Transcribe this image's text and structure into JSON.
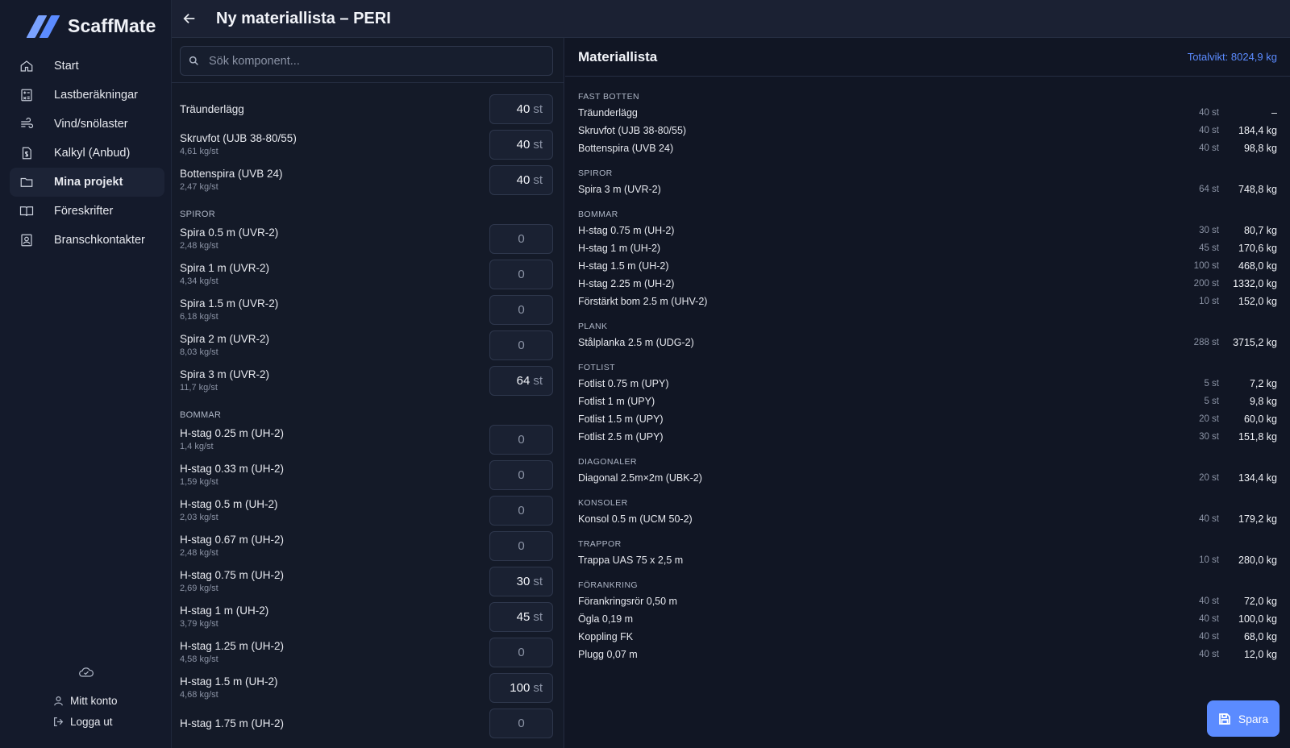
{
  "app": {
    "name": "ScaffMate"
  },
  "sidebar": {
    "items": [
      {
        "label": "Start",
        "icon": "home-icon"
      },
      {
        "label": "Lastberäkningar",
        "icon": "calculator-icon"
      },
      {
        "label": "Vind/snölaster",
        "icon": "wind-icon"
      },
      {
        "label": "Kalkyl (Anbud)",
        "icon": "invoice-icon"
      },
      {
        "label": "Mina projekt",
        "icon": "folder-icon",
        "active": true
      },
      {
        "label": "Föreskrifter",
        "icon": "book-icon"
      },
      {
        "label": "Branschkontakter",
        "icon": "contacts-icon"
      }
    ],
    "account_label": "Mitt konto",
    "logout_label": "Logga ut"
  },
  "header": {
    "title": "Ny materiallista – PERI"
  },
  "search": {
    "placeholder": "Sök komponent..."
  },
  "components": {
    "ungrouped": [
      {
        "name": "Träunderlägg",
        "weight": "",
        "qty": "40",
        "unit": "st"
      },
      {
        "name": "Skruvfot (UJB 38-80/55)",
        "weight": "4,61 kg/st",
        "qty": "40",
        "unit": "st"
      },
      {
        "name": "Bottenspira (UVB 24)",
        "weight": "2,47 kg/st",
        "qty": "40",
        "unit": "st"
      }
    ],
    "spiror_label": "SPIROR",
    "spiror": [
      {
        "name": "Spira 0.5 m (UVR-2)",
        "weight": "2,48 kg/st",
        "qty": "0",
        "unit": ""
      },
      {
        "name": "Spira 1 m (UVR-2)",
        "weight": "4,34 kg/st",
        "qty": "0",
        "unit": ""
      },
      {
        "name": "Spira 1.5 m (UVR-2)",
        "weight": "6,18 kg/st",
        "qty": "0",
        "unit": ""
      },
      {
        "name": "Spira 2 m (UVR-2)",
        "weight": "8,03 kg/st",
        "qty": "0",
        "unit": ""
      },
      {
        "name": "Spira 3 m (UVR-2)",
        "weight": "11,7 kg/st",
        "qty": "64",
        "unit": "st"
      }
    ],
    "bommar_label": "BOMMAR",
    "bommar": [
      {
        "name": "H-stag 0.25 m (UH-2)",
        "weight": "1,4 kg/st",
        "qty": "0",
        "unit": ""
      },
      {
        "name": "H-stag 0.33 m (UH-2)",
        "weight": "1,59 kg/st",
        "qty": "0",
        "unit": ""
      },
      {
        "name": "H-stag 0.5 m (UH-2)",
        "weight": "2,03 kg/st",
        "qty": "0",
        "unit": ""
      },
      {
        "name": "H-stag 0.67 m (UH-2)",
        "weight": "2,48 kg/st",
        "qty": "0",
        "unit": ""
      },
      {
        "name": "H-stag 0.75 m (UH-2)",
        "weight": "2,69 kg/st",
        "qty": "30",
        "unit": "st"
      },
      {
        "name": "H-stag 1 m (UH-2)",
        "weight": "3,79 kg/st",
        "qty": "45",
        "unit": "st"
      },
      {
        "name": "H-stag 1.25 m (UH-2)",
        "weight": "4,58 kg/st",
        "qty": "0",
        "unit": ""
      },
      {
        "name": "H-stag 1.5 m (UH-2)",
        "weight": "4,68 kg/st",
        "qty": "100",
        "unit": "st"
      },
      {
        "name": "H-stag 1.75 m (UH-2)",
        "weight": "",
        "qty": "0",
        "unit": ""
      }
    ]
  },
  "materials": {
    "title": "Materiallista",
    "total": "Totalvikt: 8024,9 kg",
    "groups": [
      {
        "label": "FAST BOTTEN",
        "rows": [
          {
            "name": "Träunderlägg",
            "qty": "40 st",
            "weight": "–"
          },
          {
            "name": "Skruvfot (UJB 38-80/55)",
            "qty": "40 st",
            "weight": "184,4 kg"
          },
          {
            "name": "Bottenspira (UVB 24)",
            "qty": "40 st",
            "weight": "98,8 kg"
          }
        ]
      },
      {
        "label": "SPIROR",
        "rows": [
          {
            "name": "Spira 3 m (UVR-2)",
            "qty": "64 st",
            "weight": "748,8 kg"
          }
        ]
      },
      {
        "label": "BOMMAR",
        "rows": [
          {
            "name": "H-stag 0.75 m (UH-2)",
            "qty": "30 st",
            "weight": "80,7 kg"
          },
          {
            "name": "H-stag 1 m (UH-2)",
            "qty": "45 st",
            "weight": "170,6 kg"
          },
          {
            "name": "H-stag 1.5 m (UH-2)",
            "qty": "100 st",
            "weight": "468,0 kg"
          },
          {
            "name": "H-stag 2.25 m (UH-2)",
            "qty": "200 st",
            "weight": "1332,0 kg"
          },
          {
            "name": "Förstärkt bom 2.5 m (UHV-2)",
            "qty": "10 st",
            "weight": "152,0 kg"
          }
        ]
      },
      {
        "label": "PLANK",
        "rows": [
          {
            "name": "Stålplanka 2.5 m (UDG-2)",
            "qty": "288 st",
            "weight": "3715,2 kg"
          }
        ]
      },
      {
        "label": "FOTLIST",
        "rows": [
          {
            "name": "Fotlist 0.75 m (UPY)",
            "qty": "5 st",
            "weight": "7,2 kg"
          },
          {
            "name": "Fotlist 1 m (UPY)",
            "qty": "5 st",
            "weight": "9,8 kg"
          },
          {
            "name": "Fotlist 1.5 m (UPY)",
            "qty": "20 st",
            "weight": "60,0 kg"
          },
          {
            "name": "Fotlist 2.5 m (UPY)",
            "qty": "30 st",
            "weight": "151,8 kg"
          }
        ]
      },
      {
        "label": "DIAGONALER",
        "rows": [
          {
            "name": "Diagonal 2.5m×2m (UBK-2)",
            "qty": "20 st",
            "weight": "134,4 kg"
          }
        ]
      },
      {
        "label": "KONSOLER",
        "rows": [
          {
            "name": "Konsol 0.5 m (UCM 50-2)",
            "qty": "40 st",
            "weight": "179,2 kg"
          }
        ]
      },
      {
        "label": "TRAPPOR",
        "rows": [
          {
            "name": "Trappa UAS 75 x 2,5 m",
            "qty": "10 st",
            "weight": "280,0 kg"
          }
        ]
      },
      {
        "label": "FÖRANKRING",
        "rows": [
          {
            "name": "Förankringsrör 0,50 m",
            "qty": "40 st",
            "weight": "72,0 kg"
          },
          {
            "name": "Ögla 0,19 m",
            "qty": "40 st",
            "weight": "100,0 kg"
          },
          {
            "name": "Koppling FK",
            "qty": "40 st",
            "weight": "68,0 kg"
          },
          {
            "name": "Plugg 0,07 m",
            "qty": "40 st",
            "weight": "12,0 kg"
          }
        ]
      }
    ]
  },
  "save_label": "Spara",
  "colors": {
    "accent": "#5b8bff",
    "background": "#0f1320",
    "sidebar": "#141a2b"
  }
}
